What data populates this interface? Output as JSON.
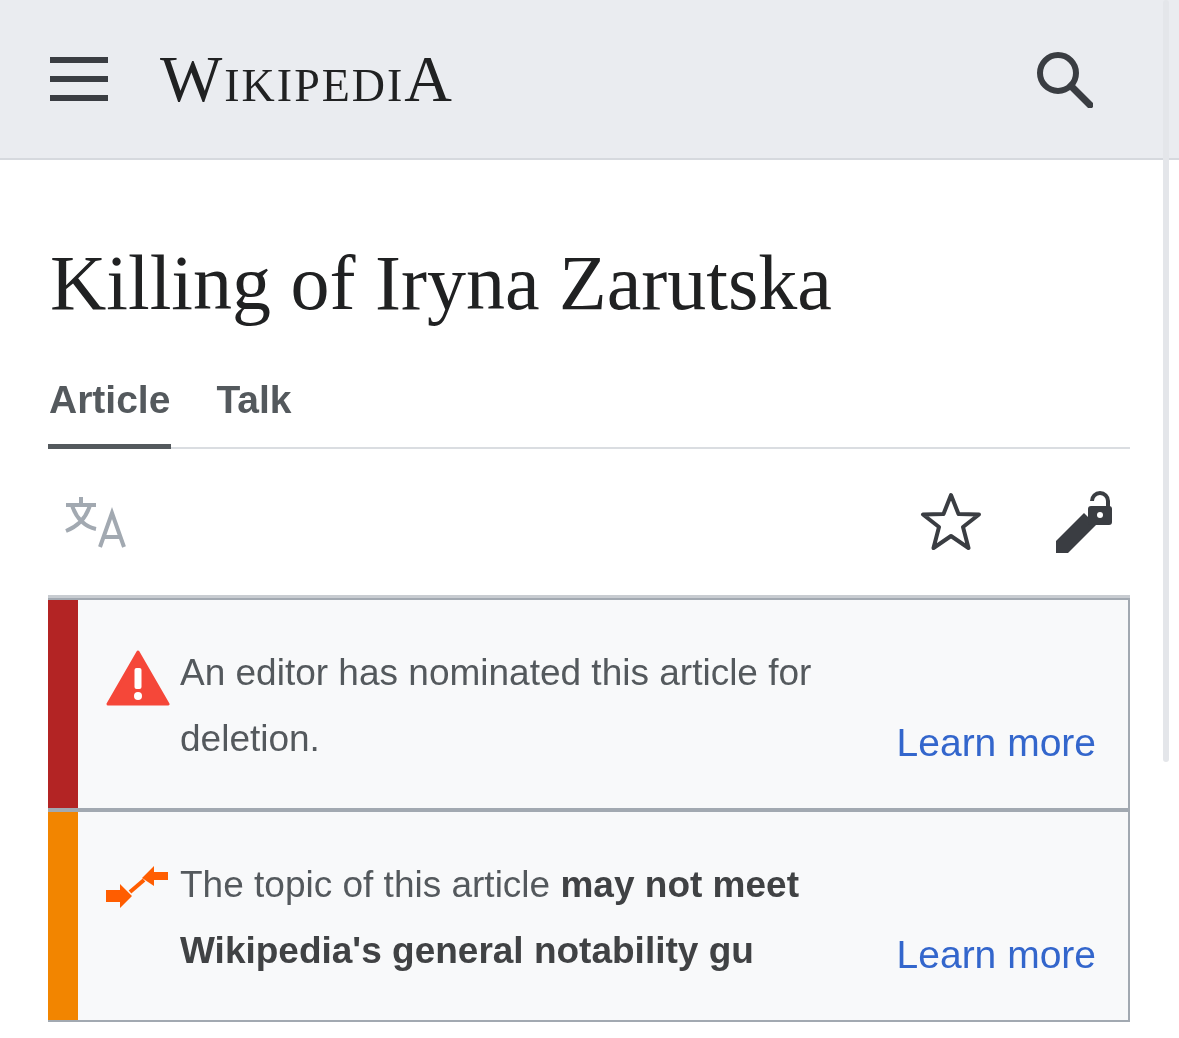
{
  "header": {
    "logo": "WikipediA"
  },
  "title": "Killing of Iryna Zarutska",
  "tabs": [
    {
      "label": "Article",
      "selected": true
    },
    {
      "label": "Talk",
      "selected": false
    }
  ],
  "notices": [
    {
      "kind": "deletion",
      "color": "#b32424",
      "text": "An editor has nominated this article for deletion.",
      "link": "Learn more"
    },
    {
      "kind": "notability",
      "color": "#f28500",
      "text": "The topic of this article **may not meet Wikipedia's general notability gu**",
      "link": "Learn more"
    }
  ]
}
